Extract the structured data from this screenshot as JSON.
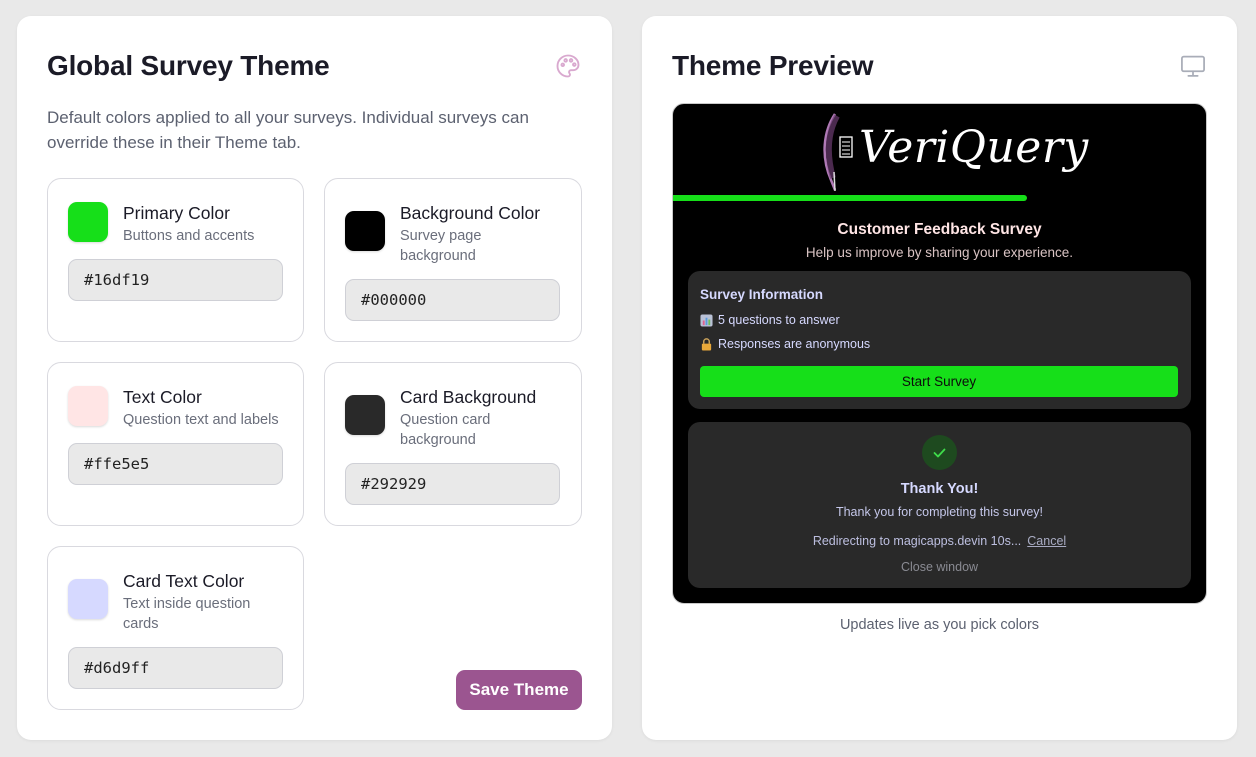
{
  "left": {
    "title": "Global Survey Theme",
    "description": "Default colors applied to all your surveys. Individual surveys can override these in their Theme tab.",
    "icon": "palette-icon",
    "colors": [
      {
        "label": "Primary Color",
        "sub": "Buttons and accents",
        "value": "#16df19"
      },
      {
        "label": "Background Color",
        "sub": "Survey page background",
        "value": "#000000"
      },
      {
        "label": "Text Color",
        "sub": "Question text and labels",
        "value": "#ffe5e5"
      },
      {
        "label": "Card Background",
        "sub": "Question card background",
        "value": "#292929"
      },
      {
        "label": "Card Text Color",
        "sub": "Text inside question cards",
        "value": "#d6d9ff"
      }
    ],
    "save_label": "Save Theme"
  },
  "right": {
    "title": "Theme Preview",
    "icon": "monitor-icon",
    "preview": {
      "logo_text": "VeriQuery",
      "progress": 0.665,
      "survey_title": "Customer Feedback Survey",
      "survey_subtitle": "Help us improve by sharing your experience.",
      "info_title": "Survey Information",
      "info_rows": [
        "5 questions to answer",
        "Responses are anonymous"
      ],
      "start_label": "Start Survey",
      "thanks_title": "Thank You!",
      "thanks_sub": "Thank you for completing this survey!",
      "redirect_text": "Redirecting to magicapps.devin 10s...",
      "cancel_label": "Cancel",
      "close_label": "Close window"
    },
    "caption": "Updates live as you pick colors"
  },
  "accent": "#9b5590"
}
